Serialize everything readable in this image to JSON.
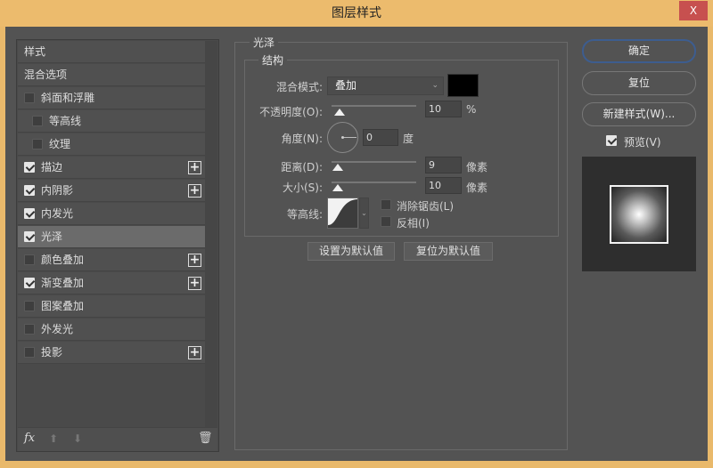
{
  "window": {
    "title": "图层样式",
    "close": "X",
    "colors": {
      "titlebar": "#ecbb6d",
      "close": "#c7504f",
      "panel": "#535353"
    }
  },
  "styles_list": {
    "header": "样式",
    "blend_options": "混合选项",
    "items": [
      {
        "label": "斜面和浮雕",
        "checked": false,
        "plus": false,
        "indent": false
      },
      {
        "label": "等高线",
        "checked": false,
        "plus": false,
        "indent": true
      },
      {
        "label": "纹理",
        "checked": false,
        "plus": false,
        "indent": true
      },
      {
        "label": "描边",
        "checked": true,
        "plus": true,
        "indent": false
      },
      {
        "label": "内阴影",
        "checked": true,
        "plus": true,
        "indent": false
      },
      {
        "label": "内发光",
        "checked": true,
        "plus": false,
        "indent": false
      },
      {
        "label": "光泽",
        "checked": true,
        "plus": false,
        "indent": false,
        "selected": true
      },
      {
        "label": "颜色叠加",
        "checked": false,
        "plus": true,
        "indent": false
      },
      {
        "label": "渐变叠加",
        "checked": true,
        "plus": true,
        "indent": false
      },
      {
        "label": "图案叠加",
        "checked": false,
        "plus": false,
        "indent": false
      },
      {
        "label": "外发光",
        "checked": false,
        "plus": false,
        "indent": false
      },
      {
        "label": "投影",
        "checked": false,
        "plus": true,
        "indent": false
      }
    ],
    "toolbar": {
      "fx": "fx",
      "icons": [
        "fx-icon",
        "arrow-up-icon",
        "arrow-down-icon",
        "trash-icon"
      ]
    }
  },
  "satin": {
    "title": "光泽",
    "structure": "结构",
    "blend_mode_label": "混合模式:",
    "blend_mode": "叠加",
    "color": "#000000",
    "opacity_label": "不透明度(O):",
    "opacity": "10",
    "opacity_unit": "%",
    "angle_label": "角度(N):",
    "angle": "0",
    "angle_unit": "度",
    "distance_label": "距离(D):",
    "distance": "9",
    "distance_unit": "像素",
    "size_label": "大小(S):",
    "size": "10",
    "size_unit": "像素",
    "contour_label": "等高线:",
    "antialias_label": "消除锯齿(L)",
    "antialias": false,
    "invert_label": "反相(I)",
    "invert": false,
    "make_default": "设置为默认值",
    "reset_default": "复位为默认值"
  },
  "right": {
    "ok": "确定",
    "reset": "复位",
    "new_style": "新建样式(W)...",
    "preview_label": "预览(V)",
    "preview": true
  }
}
